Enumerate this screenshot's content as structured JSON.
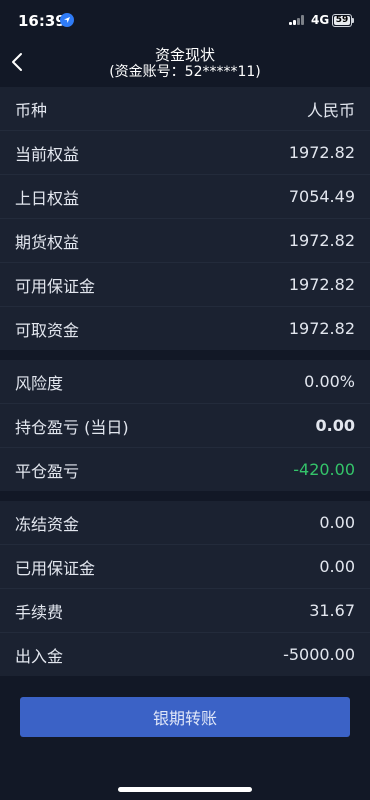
{
  "status_bar": {
    "time": "16:39",
    "network": "4G",
    "battery": "59"
  },
  "nav": {
    "title": "资金现状",
    "subtitle": "(资金账号：52*****11)"
  },
  "sections": [
    [
      {
        "label": "币种",
        "value": "人民币"
      },
      {
        "label": "当前权益",
        "value": "1972.82"
      },
      {
        "label": "上日权益",
        "value": "7054.49"
      },
      {
        "label": "期货权益",
        "value": "1972.82"
      },
      {
        "label": "可用保证金",
        "value": "1972.82"
      },
      {
        "label": "可取资金",
        "value": "1972.82"
      }
    ],
    [
      {
        "label": "风险度",
        "value": "0.00%"
      },
      {
        "label": "持仓盈亏 (当日)",
        "value": "0.00"
      },
      {
        "label": "平仓盈亏",
        "value": "-420.00"
      }
    ],
    [
      {
        "label": "冻结资金",
        "value": "0.00"
      },
      {
        "label": "已用保证金",
        "value": "0.00"
      },
      {
        "label": "手续费",
        "value": "31.67"
      },
      {
        "label": "出入金",
        "value": "-5000.00"
      }
    ]
  ],
  "colors": {
    "loss": "#34c46a",
    "accent": "#3b62c6",
    "background": "#121826",
    "row_bg": "#1b2231"
  },
  "icons": {
    "back": "chevron-left-icon",
    "location": "location-arrow-icon",
    "signal": "signal-icon",
    "battery": "battery-icon"
  },
  "actions": {
    "transfer_label": "银期转账"
  }
}
